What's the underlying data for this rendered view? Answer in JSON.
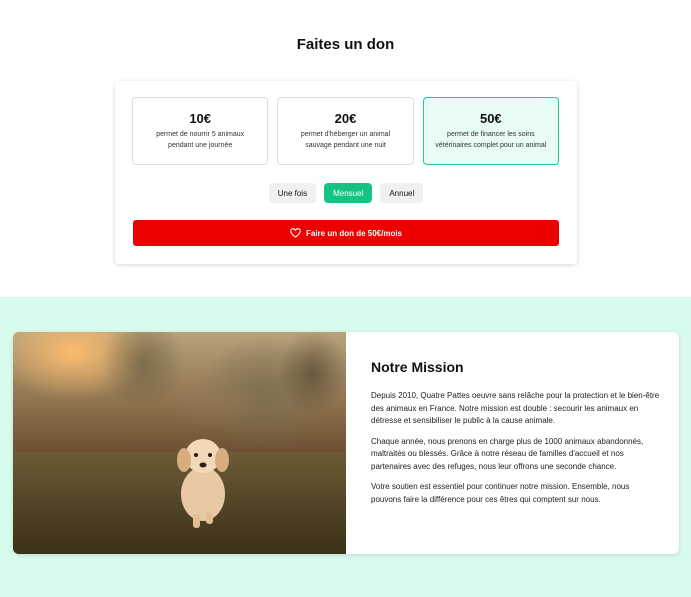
{
  "donation": {
    "title": "Faites un don",
    "amounts": [
      {
        "value": "10€",
        "description": "permet de nourrir 5 animaux pendant une journée"
      },
      {
        "value": "20€",
        "description": "permet  d'héberger un animal sauvage pendant une nuit"
      },
      {
        "value": "50€",
        "description": "permet de financer les soins vétérinaires complet pour un animal"
      }
    ],
    "selected_amount": "50€",
    "frequencies": [
      "Une fois",
      "Mensuel",
      "Annuel"
    ],
    "selected_frequency": "Mensuel",
    "submit_label": "Faire un don de 50€/mois"
  },
  "mission": {
    "title": "Notre Mission",
    "paragraphs": [
      "Depuis 2010, Quatre Pattes oeuvre sans relâche pour la protection et le bien-être des animaux en France. Notre mission est double : secourir les animaux en détresse et sensibiliser le public à la cause animale.",
      "Chaque année, nous prenons en charge plus de 1000 animaux abandonnés, maltraités ou blessés. Grâce à notre réseau de familles d'accueil et nos partenaires avec des refuges, nous leur offrons une seconde chance.",
      "Votre soutien est essentiel pour continuer notre mission. Ensemble, nous pouvons faire la différence pour ces êtres qui comptent sur nous."
    ],
    "image_icon": "puppy-photo"
  },
  "icons": {
    "donate": "heart-icon"
  },
  "colors": {
    "accent_green": "#12c382",
    "selected_border": "#1dc9a4",
    "selected_bg": "#e8fbf5",
    "donate_red": "#ec0000",
    "section_bg": "#d7fbec"
  }
}
